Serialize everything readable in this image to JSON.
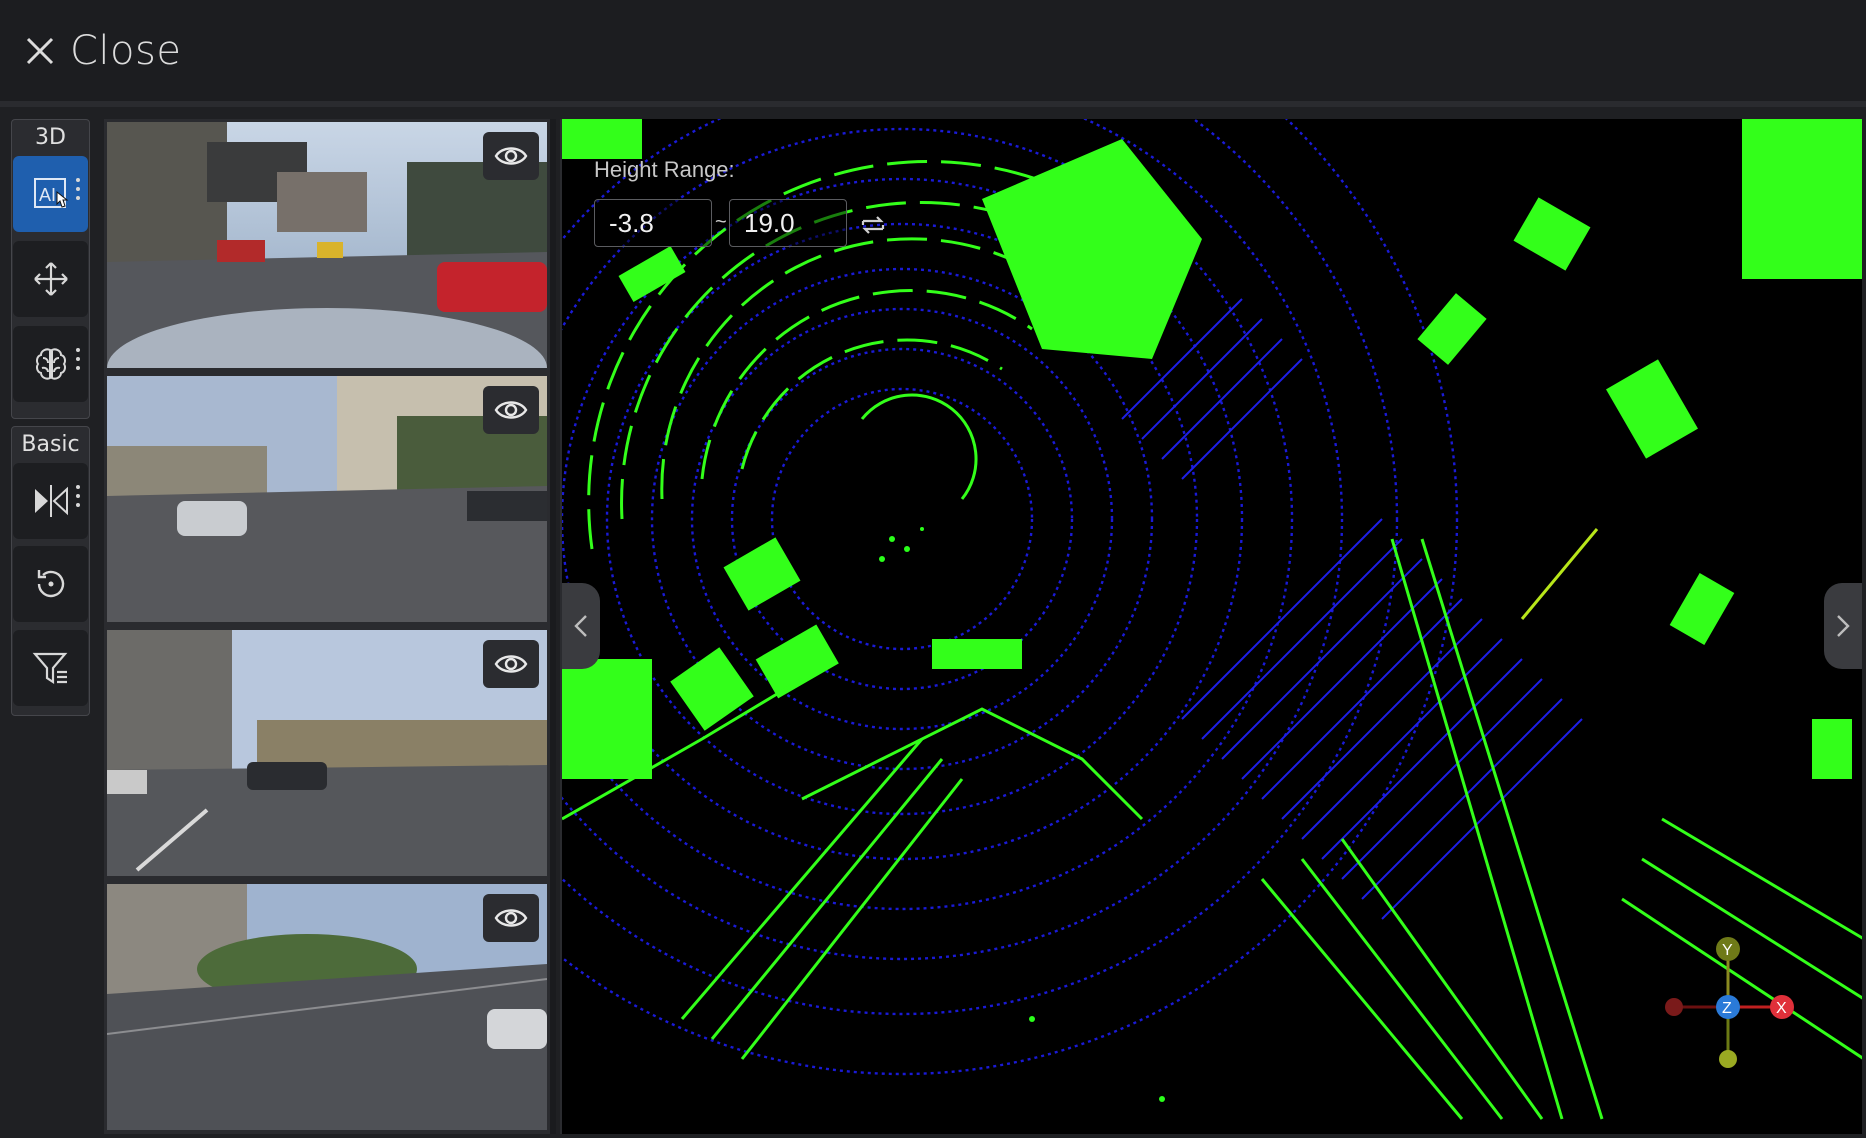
{
  "header": {
    "close_label": "Close",
    "close_icon": "x-icon"
  },
  "toolbar": {
    "group_3d_title": "3D",
    "group_basic_title": "Basic",
    "tools": [
      {
        "name": "ai-annotate-icon",
        "label": "AI",
        "active": true,
        "has_menu": true
      },
      {
        "name": "move-icon",
        "active": false,
        "has_menu": false
      },
      {
        "name": "brain-icon",
        "active": false,
        "has_menu": true
      },
      {
        "name": "flip-icon",
        "active": false,
        "has_menu": true
      },
      {
        "name": "reset-view-icon",
        "active": false,
        "has_menu": false
      },
      {
        "name": "filter-icon",
        "active": false,
        "has_menu": false
      }
    ]
  },
  "cameras": [
    {
      "id": "cam-front",
      "visible": true
    },
    {
      "id": "cam-left",
      "visible": true
    },
    {
      "id": "cam-right",
      "visible": true
    },
    {
      "id": "cam-rear",
      "visible": true
    }
  ],
  "viewer": {
    "height_range_label": "Height Range:",
    "height_min": "-3.8",
    "height_max": "19.0",
    "range_separator": "~",
    "axis_labels": {
      "x": "X",
      "y": "Y",
      "z": "Z"
    },
    "colors": {
      "ground": "#1414d8",
      "object": "#33ff1a",
      "background": "#000000",
      "accent": "#1f5fae"
    }
  }
}
